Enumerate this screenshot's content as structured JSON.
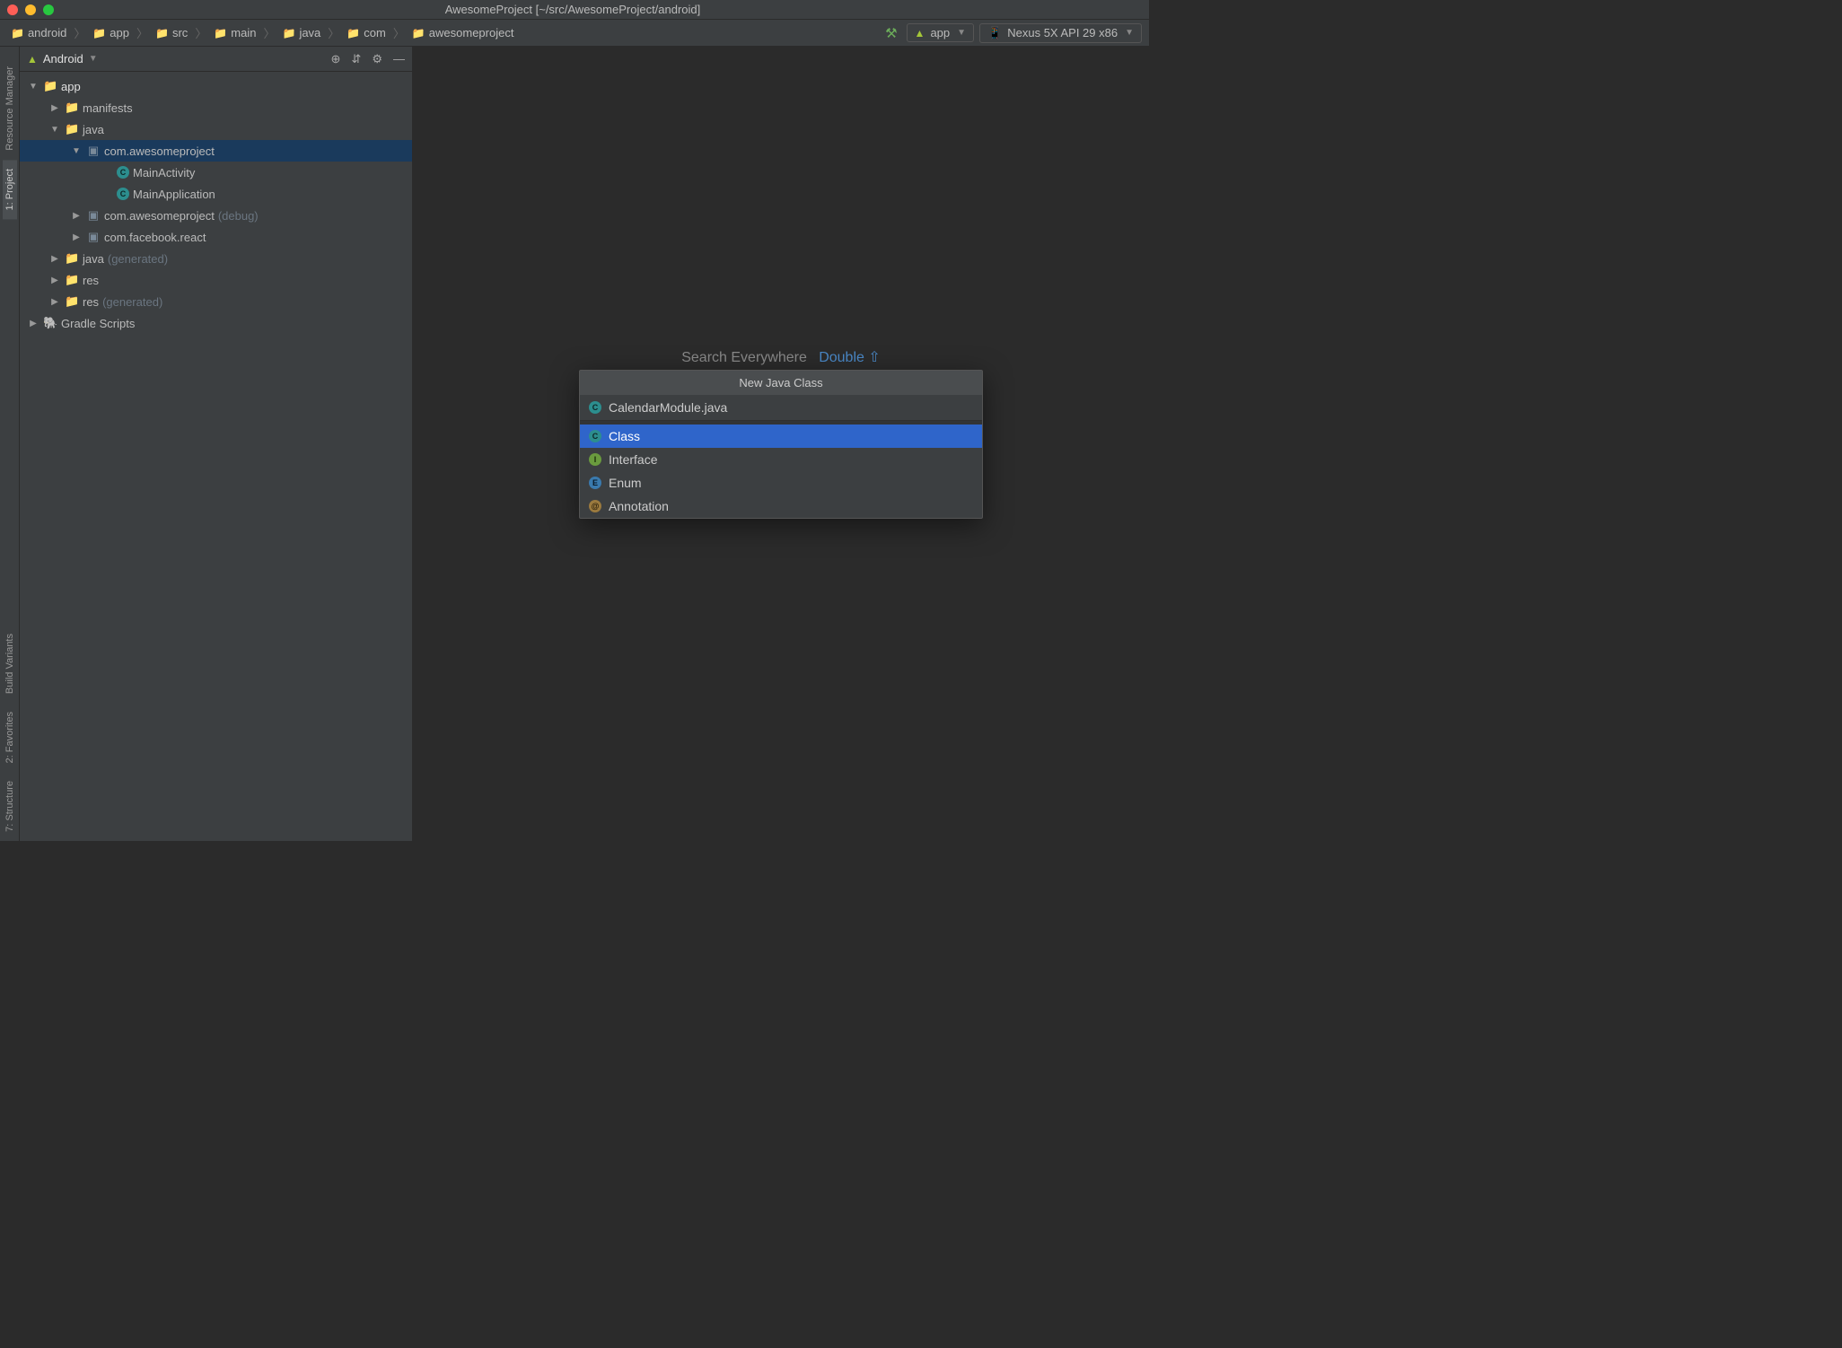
{
  "title": "AwesomeProject [~/src/AwesomeProject/android]",
  "breadcrumb": [
    "android",
    "app",
    "src",
    "main",
    "java",
    "com",
    "awesomeproject"
  ],
  "toolbar": {
    "runConfig": "app",
    "device": "Nexus 5X API 29 x86"
  },
  "panel": {
    "viewMode": "Android"
  },
  "tree": {
    "app": "app",
    "manifests": "manifests",
    "java": "java",
    "pkg1": "com.awesomeproject",
    "mainActivity": "MainActivity",
    "mainApplication": "MainApplication",
    "pkg2": "com.awesomeproject",
    "pkg2suffix": "(debug)",
    "pkg3": "com.facebook.react",
    "java2": "java",
    "java2suffix": "(generated)",
    "res": "res",
    "res2": "res",
    "res2suffix": "(generated)",
    "gradle": "Gradle Scripts"
  },
  "hint": {
    "label": "Search Everywhere",
    "key": "Double ⇧"
  },
  "popup": {
    "title": "New Java Class",
    "input": "CalendarModule.java",
    "items": [
      "Class",
      "Interface",
      "Enum",
      "Annotation"
    ]
  },
  "dock": {
    "resourceManager": "Resource Manager",
    "project": "1: Project",
    "buildVariants": "Build Variants",
    "favorites": "2: Favorites",
    "structure": "7: Structure"
  }
}
